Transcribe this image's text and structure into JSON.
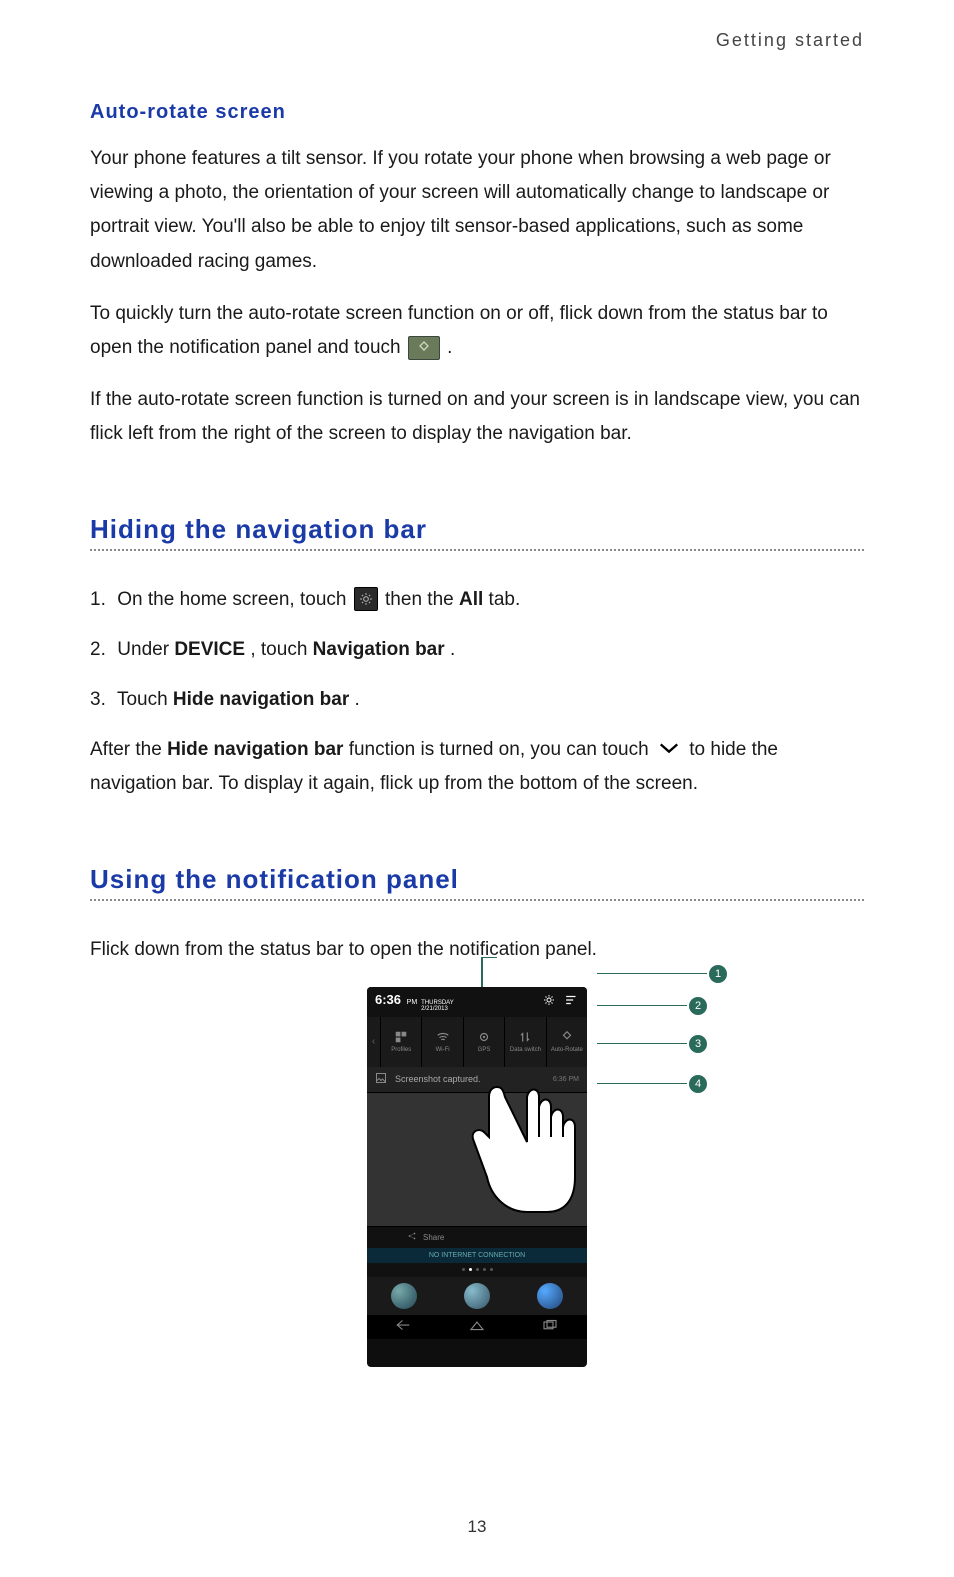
{
  "header": {
    "section": "Getting started"
  },
  "auto_rotate": {
    "heading": "Auto-rotate screen",
    "para1": "Your phone features a tilt sensor. If you rotate your phone when browsing a web page or viewing a photo, the orientation of your screen will automatically change to landscape or portrait view. You'll also be able to enjoy tilt sensor-based applications, such as some downloaded racing games.",
    "para2_a": "To quickly turn the auto-rotate screen function on or off, flick down from the status bar to open the notification panel and touch ",
    "para2_b": " .",
    "para3": "If the auto-rotate screen function is turned on and your screen is in landscape view, you can flick left from the right of the screen to display the navigation bar."
  },
  "hiding": {
    "heading": "Hiding the navigation bar",
    "step1_a": "On the home screen, touch ",
    "step1_b": " then the ",
    "step1_bold": "All",
    "step1_c": " tab.",
    "step2_a": "Under ",
    "step2_bold1": "DEVICE",
    "step2_b": ", touch ",
    "step2_bold2": "Navigation bar",
    "step2_c": ".",
    "step3_a": "Touch ",
    "step3_bold": "Hide navigation bar",
    "step3_b": ".",
    "after_a": "After the ",
    "after_bold": "Hide navigation bar",
    "after_b": " function is turned on, you can touch ",
    "after_c": " to hide the navigation bar. To display it again, flick up from the bottom of the screen."
  },
  "notif": {
    "heading": "Using the notification panel",
    "para": "Flick down from the status bar to open the notification panel."
  },
  "phone": {
    "time": "6:36",
    "ampm": "PM",
    "day": "THURSDAY",
    "date": "2/21/2013",
    "toggles": [
      "Profiles",
      "Wi-Fi",
      "GPS",
      "Data switch",
      "Auto-Rotate"
    ],
    "notif_text": "Screenshot captured.",
    "notif_time": "6:36 PM",
    "share": "Share",
    "no_internet": "NO INTERNET CONNECTION"
  },
  "callouts": [
    "1",
    "2",
    "3",
    "4"
  ],
  "pagenum": "13"
}
